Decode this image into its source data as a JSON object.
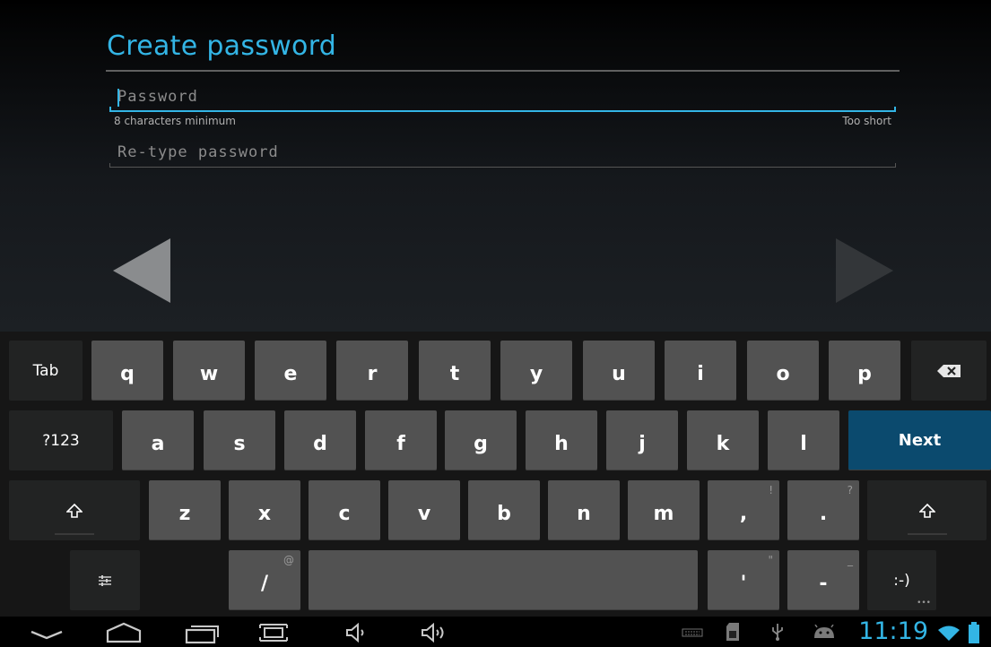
{
  "header": {
    "title": "Create password"
  },
  "form": {
    "password": {
      "placeholder": "Password",
      "value": ""
    },
    "hint_left": "8 characters minimum",
    "hint_right": "Too short",
    "retype": {
      "placeholder": "Re-type password",
      "value": ""
    }
  },
  "keyboard": {
    "row1": [
      "Tab",
      "q",
      "w",
      "e",
      "r",
      "t",
      "y",
      "u",
      "i",
      "o",
      "p"
    ],
    "row2": [
      "?123",
      "a",
      "s",
      "d",
      "f",
      "g",
      "h",
      "j",
      "k",
      "l",
      "Next"
    ],
    "row3": [
      "z",
      "x",
      "c",
      "v",
      "b",
      "n",
      "m",
      ",",
      "."
    ],
    "row3_alts": {
      "comma": "!",
      "period": "?"
    },
    "row4": {
      "slash": "/",
      "slash_alt": "@",
      "apostrophe": "'",
      "apostrophe_alt": "\"",
      "dash": "-",
      "dash_alt": "_",
      "smiley": ":-)"
    }
  },
  "status_bar": {
    "time": "11:19"
  },
  "colors": {
    "accent": "#33b5e5",
    "key": "#525252",
    "key_dark": "#222323",
    "next_key": "#0b4a6e"
  },
  "icons": [
    "back-icon",
    "home-icon",
    "recent-apps-icon",
    "screenshot-icon",
    "volume-down-icon",
    "volume-up-icon",
    "keyboard-icon",
    "sd-card-icon",
    "usb-icon",
    "android-debug-icon",
    "wifi-icon",
    "battery-icon",
    "backspace-icon",
    "shift-icon",
    "settings-icon"
  ]
}
